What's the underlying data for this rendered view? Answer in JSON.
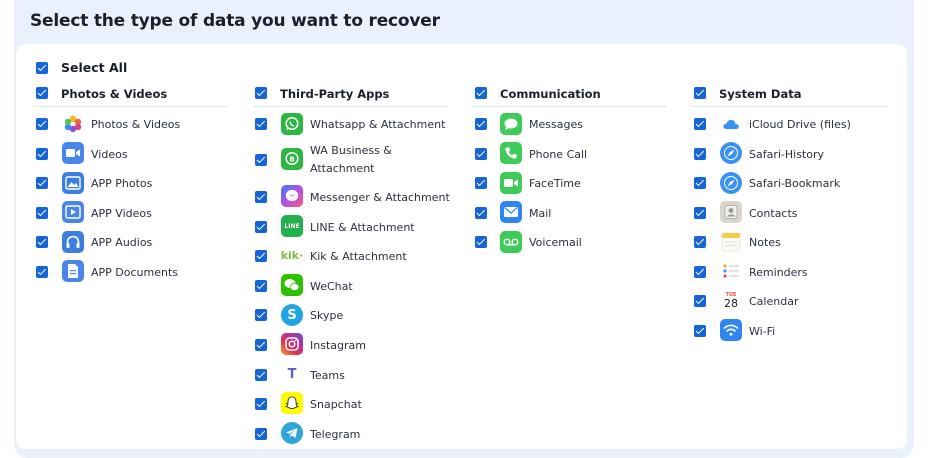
{
  "header": {
    "title": "Select the type of data you want to recover"
  },
  "select_all": {
    "label": "Select All"
  },
  "columns": [
    {
      "title": "Photos & Videos",
      "items": [
        {
          "label": "Photos & Videos",
          "icon": "photos-icon"
        },
        {
          "label": "Videos",
          "icon": "video-camera-icon"
        },
        {
          "label": "APP Photos",
          "icon": "app-photos-icon"
        },
        {
          "label": "APP Videos",
          "icon": "app-videos-icon"
        },
        {
          "label": "APP Audios",
          "icon": "headphones-icon"
        },
        {
          "label": "APP Documents",
          "icon": "document-icon"
        }
      ]
    },
    {
      "title": "Third-Party Apps",
      "items": [
        {
          "label": "Whatsapp & Attachment",
          "icon": "whatsapp-icon"
        },
        {
          "label_line1": "WA Business &",
          "label_line2": "Attachment",
          "icon": "wa-business-icon"
        },
        {
          "label": "Messenger & Attachment",
          "icon": "messenger-icon"
        },
        {
          "label": "LINE & Attachment",
          "icon": "line-icon",
          "icon_text": "LINE"
        },
        {
          "label": "Kik & Attachment",
          "icon": "kik-icon",
          "icon_text": "kik·"
        },
        {
          "label": "WeChat",
          "icon": "wechat-icon"
        },
        {
          "label": "Skype",
          "icon": "skype-icon",
          "icon_text": "S"
        },
        {
          "label": "Instagram",
          "icon": "instagram-icon"
        },
        {
          "label": "Teams",
          "icon": "teams-icon",
          "icon_text": "T"
        },
        {
          "label": "Snapchat",
          "icon": "snapchat-icon"
        },
        {
          "label": "Telegram",
          "icon": "telegram-icon"
        }
      ]
    },
    {
      "title": "Communication",
      "items": [
        {
          "label": "Messages",
          "icon": "messages-icon"
        },
        {
          "label": "Phone Call",
          "icon": "phone-icon"
        },
        {
          "label": "FaceTime",
          "icon": "facetime-icon"
        },
        {
          "label": "Mail",
          "icon": "mail-icon"
        },
        {
          "label": "Voicemail",
          "icon": "voicemail-icon"
        }
      ]
    },
    {
      "title": "System Data",
      "items": [
        {
          "label": "iCloud Drive (files)",
          "icon": "icloud-icon"
        },
        {
          "label": "Safari-History",
          "icon": "safari-icon"
        },
        {
          "label": "Safari-Bookmark",
          "icon": "safari-icon"
        },
        {
          "label": "Contacts",
          "icon": "contacts-icon"
        },
        {
          "label": "Notes",
          "icon": "notes-icon"
        },
        {
          "label": "Reminders",
          "icon": "reminders-icon"
        },
        {
          "label": "Calendar",
          "icon": "calendar-icon",
          "icon_month": "TUE",
          "icon_day": "28"
        },
        {
          "label": "Wi-Fi",
          "icon": "wifi-icon"
        }
      ]
    }
  ],
  "colors": {
    "accent": "#1565d8",
    "panel": "#eaf1fd"
  }
}
